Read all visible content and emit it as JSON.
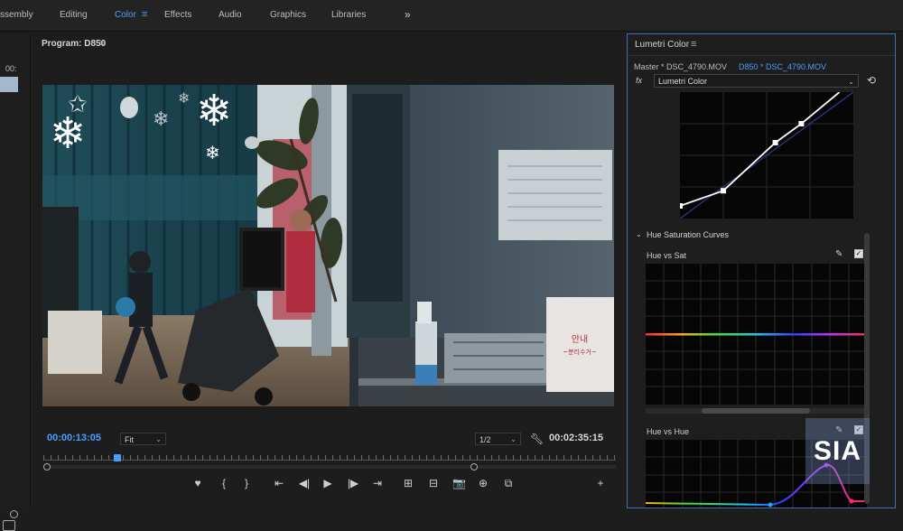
{
  "workspaces": {
    "tabs": [
      "ssembly",
      "Editing",
      "Color",
      "Effects",
      "Audio",
      "Graphics",
      "Libraries"
    ],
    "active": "Color",
    "more_icon": "double-chevron-right-icon"
  },
  "left_panel": {
    "time_partial": "00:"
  },
  "program": {
    "title": "Program: D850",
    "current_time": "00:00:13:05",
    "fit": "Fit",
    "resolution": "1/2",
    "duration": "00:02:35:15",
    "controls": [
      "add-marker-icon",
      "mark-in-icon",
      "mark-out-icon",
      "go-to-in-icon",
      "step-back-icon",
      "play-icon",
      "step-forward-icon",
      "go-to-out-icon",
      "insert-icon",
      "overwrite-icon",
      "export-frame-icon",
      "compare-view-icon",
      "multicam-icon",
      "add-button-icon"
    ],
    "control_glyphs": [
      "♥",
      "{",
      "}",
      "⇤",
      "◀|",
      "▶",
      "|▶",
      "⇥",
      "⊞",
      "⊟",
      "📷",
      "⊕",
      "⧉",
      "+"
    ],
    "playhead_fraction": 0.13,
    "sign_text": [
      "안내",
      "~분리수거~"
    ]
  },
  "lumetri": {
    "title": "Lumetri Color",
    "master_label": "Master * DSC_4790.MOV",
    "clip_label": "D850 * DSC_4790.MOV",
    "fx_label": "fx",
    "effect": "Lumetri Color",
    "reset_icon": "reset-icon",
    "curves_points": [
      [
        0,
        0.1
      ],
      [
        0.25,
        0.22
      ],
      [
        0.55,
        0.6
      ],
      [
        0.7,
        0.75
      ],
      [
        0.92,
        1.0
      ]
    ],
    "hue_sat_title": "Hue Saturation Curves",
    "hue_vs_sat": "Hue vs Sat",
    "hue_vs_hue": "Hue vs Hue",
    "eyedropper_icon": "eyedropper-icon",
    "checkbox_icon": "checkbox-checked-icon"
  },
  "watermark": "SIA",
  "colors": {
    "accent": "#4a9eff",
    "panel_border": "#3d6fb3",
    "curve": "#ffffff",
    "hue_line": "spectrum"
  }
}
